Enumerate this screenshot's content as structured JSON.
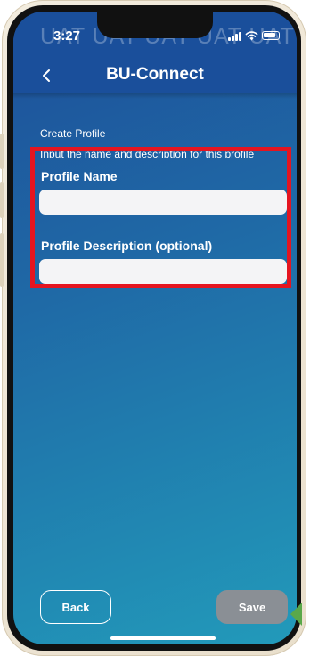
{
  "status_bar": {
    "time": "3:27"
  },
  "watermark": "UAT UAT UAT UAT UAT",
  "header": {
    "title": "BU-Connect"
  },
  "section": {
    "title": "Create Profile",
    "subtitle": "Input the name and description for this profile"
  },
  "form": {
    "name_label": "Profile Name",
    "name_value": "",
    "description_label": "Profile Description (optional)",
    "description_value": ""
  },
  "buttons": {
    "back": "Back",
    "save": "Save"
  },
  "colors": {
    "header_bg": "#1a4f9b",
    "gradient_start": "#1e4f99",
    "gradient_end": "#229aba",
    "highlight": "#e51520",
    "save_disabled": "#8a8f95",
    "annotation_arrow": "#5aa84a"
  }
}
